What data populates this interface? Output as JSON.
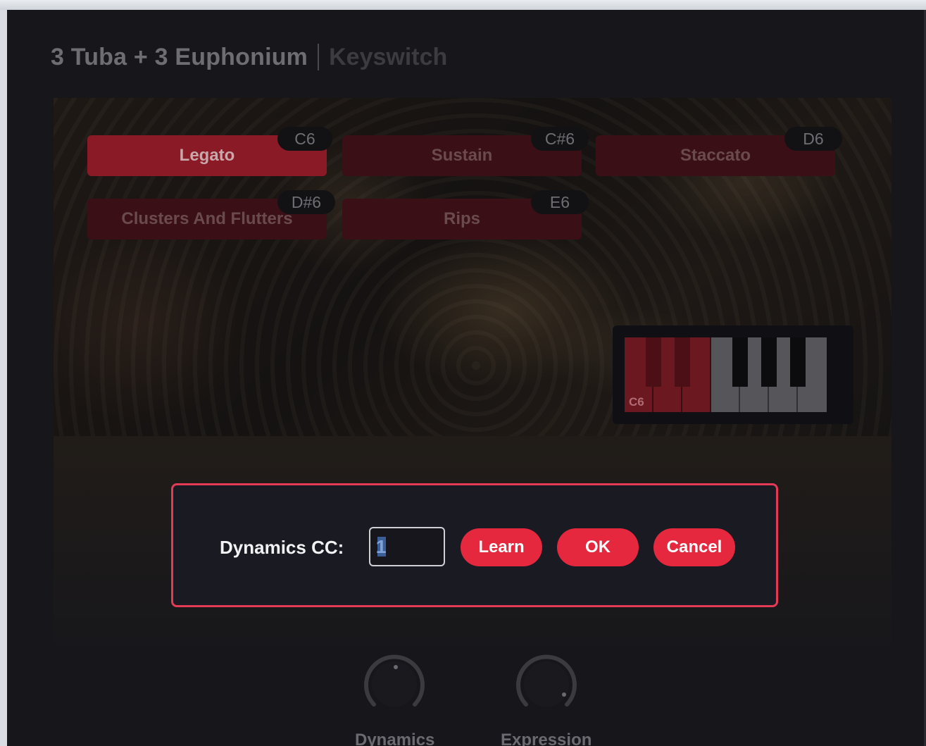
{
  "window": {
    "title_main": "3 Tuba + 3 Euphonium",
    "title_sub": "Keyswitch"
  },
  "keyswitches": [
    {
      "label": "Legato",
      "note": "C6",
      "active": true
    },
    {
      "label": "Sustain",
      "note": "C#6",
      "active": false
    },
    {
      "label": "Staccato",
      "note": "D6",
      "active": false
    },
    {
      "label": "Clusters And Flutters",
      "note": "D#6",
      "active": false
    },
    {
      "label": "Rips",
      "note": "E6",
      "active": false
    }
  ],
  "keyboard": {
    "start_label": "C6"
  },
  "dialog": {
    "label": "Dynamics CC:",
    "value": "1",
    "learn": "Learn",
    "ok": "OK",
    "cancel": "Cancel"
  },
  "knobs": [
    {
      "label": "Dynamics"
    },
    {
      "label": "Expression"
    }
  ],
  "colors": {
    "accent": "#e6283f",
    "dialog_border": "#e33b55",
    "active_keyswitch": "#8a1a26"
  }
}
